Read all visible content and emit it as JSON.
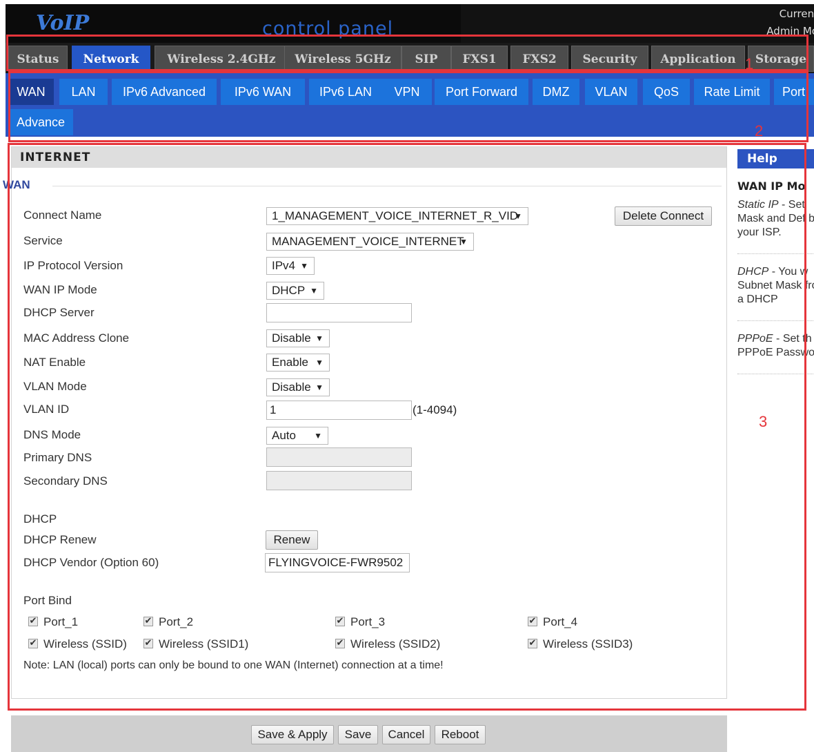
{
  "header": {
    "logo": "VoIP",
    "title": "control panel",
    "current_user_line1": "Current",
    "current_user_line2": "Admin Mo"
  },
  "main_tabs": [
    "Status",
    "Network",
    "Wireless 2.4GHz",
    "Wireless 5GHz",
    "SIP",
    "FXS1",
    "FXS2",
    "Security",
    "Application",
    "Storage"
  ],
  "sub_tabs": [
    "WAN",
    "LAN",
    "IPv6 Advanced",
    "IPv6 WAN",
    "IPv6 LAN",
    "VPN",
    "Port Forward",
    "DMZ",
    "VLAN",
    "QoS",
    "Rate Limit",
    "Port",
    "Advance"
  ],
  "annotations": [
    "1",
    "2",
    "3"
  ],
  "panel": {
    "heading": "INTERNET",
    "section": "WAN",
    "fields": {
      "connect_name": {
        "label": "Connect Name",
        "value": "1_MANAGEMENT_VOICE_INTERNET_R_VID"
      },
      "service": {
        "label": "Service",
        "value": "MANAGEMENT_VOICE_INTERNET"
      },
      "ip_protocol": {
        "label": "IP Protocol Version",
        "value": "IPv4"
      },
      "wan_ip_mode": {
        "label": "WAN IP Mode",
        "value": "DHCP"
      },
      "dhcp_server": {
        "label": "DHCP Server",
        "value": ""
      },
      "mac_clone": {
        "label": "MAC Address Clone",
        "value": "Disable"
      },
      "nat_enable": {
        "label": "NAT Enable",
        "value": "Enable"
      },
      "vlan_mode": {
        "label": "VLAN Mode",
        "value": "Disable"
      },
      "vlan_id": {
        "label": "VLAN ID",
        "value": "1",
        "range": "(1-4094)"
      },
      "dns_mode": {
        "label": "DNS Mode",
        "value": "Auto"
      },
      "primary_dns": {
        "label": "Primary DNS",
        "value": ""
      },
      "secondary_dns": {
        "label": "Secondary DNS",
        "value": ""
      }
    },
    "delete_connect": "Delete Connect",
    "dhcp_section": "DHCP",
    "dhcp_renew_label": "DHCP Renew",
    "renew_button": "Renew",
    "dhcp_vendor_label": "DHCP Vendor (Option 60)",
    "dhcp_vendor_value": "FLYINGVOICE-FWR9502",
    "port_bind_label": "Port Bind",
    "ports": [
      "Port_1",
      "Port_2",
      "Port_3",
      "Port_4"
    ],
    "wireless": [
      "Wireless (SSID)",
      "Wireless (SSID1)",
      "Wireless (SSID2)",
      "Wireless (SSID3)"
    ],
    "note": "Note: LAN (local) ports can only be bound to one WAN (Internet) connection at a time!"
  },
  "help": {
    "heading": "Help",
    "title": "WAN IP Mo",
    "items": [
      {
        "name": "Static IP",
        "text": " - Set Mask and Def by your ISP."
      },
      {
        "name": "DHCP",
        "text": " - You w Subnet Mask from a DHCP"
      },
      {
        "name": "PPPoE",
        "text": " - Set th PPPoE Passwo"
      }
    ]
  },
  "footer": {
    "save_apply": "Save & Apply",
    "save": "Save",
    "cancel": "Cancel",
    "reboot": "Reboot"
  },
  "colors": {
    "accent": "#2c54c1",
    "tab_active": "#2557c7",
    "annotation": "#e5353b"
  }
}
